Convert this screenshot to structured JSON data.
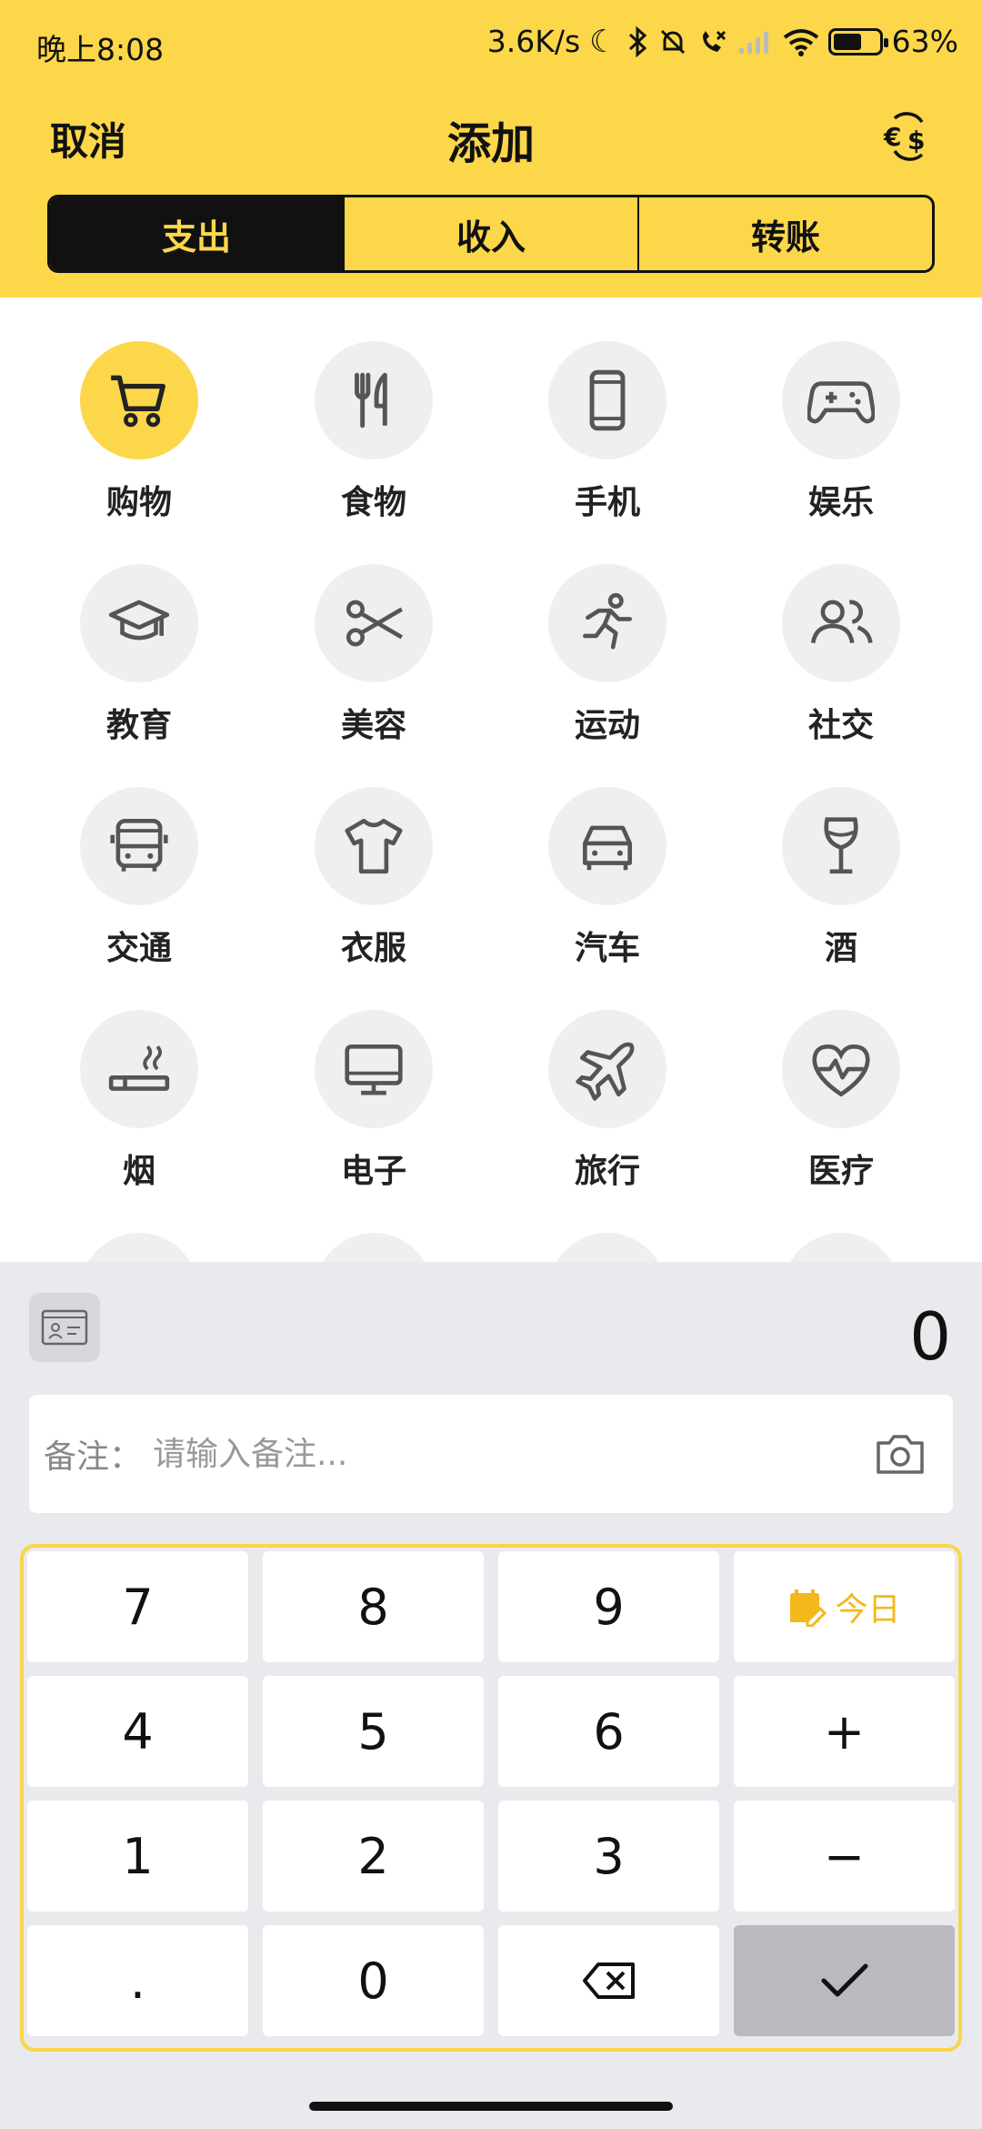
{
  "status_bar": {
    "time": "晚上8:08",
    "network_speed": "3.6K/s",
    "battery_percent": "63%",
    "battery_level": 0.63
  },
  "nav": {
    "cancel_label": "取消",
    "title": "添加",
    "currency_icon": "currency-exchange-icon"
  },
  "tabs": [
    {
      "label": "支出",
      "active": true
    },
    {
      "label": "收入",
      "active": false
    },
    {
      "label": "转账",
      "active": false
    }
  ],
  "categories": [
    {
      "label": "购物",
      "icon": "shopping-cart-icon",
      "selected": true
    },
    {
      "label": "食物",
      "icon": "fork-knife-icon",
      "selected": false
    },
    {
      "label": "手机",
      "icon": "phone-icon",
      "selected": false
    },
    {
      "label": "娱乐",
      "icon": "gamepad-icon",
      "selected": false
    },
    {
      "label": "教育",
      "icon": "graduation-cap-icon",
      "selected": false
    },
    {
      "label": "美容",
      "icon": "scissors-icon",
      "selected": false
    },
    {
      "label": "运动",
      "icon": "running-icon",
      "selected": false
    },
    {
      "label": "社交",
      "icon": "people-icon",
      "selected": false
    },
    {
      "label": "交通",
      "icon": "bus-icon",
      "selected": false
    },
    {
      "label": "衣服",
      "icon": "tshirt-icon",
      "selected": false
    },
    {
      "label": "汽车",
      "icon": "car-icon",
      "selected": false
    },
    {
      "label": "酒",
      "icon": "wine-glass-icon",
      "selected": false
    },
    {
      "label": "烟",
      "icon": "cigarette-icon",
      "selected": false
    },
    {
      "label": "电子",
      "icon": "monitor-icon",
      "selected": false
    },
    {
      "label": "旅行",
      "icon": "airplane-icon",
      "selected": false
    },
    {
      "label": "医疗",
      "icon": "heartbeat-icon",
      "selected": false
    }
  ],
  "entry": {
    "amount": "0",
    "remark_label": "备注：",
    "remark_placeholder": "请输入备注..."
  },
  "keypad": {
    "k7": "7",
    "k8": "8",
    "k9": "9",
    "today": "今日",
    "k4": "4",
    "k5": "5",
    "k6": "6",
    "plus": "+",
    "k1": "1",
    "k2": "2",
    "k3": "3",
    "minus": "−",
    "dot": ".",
    "k0": "0",
    "backspace_icon": "backspace-icon",
    "confirm_icon": "checkmark-icon"
  },
  "colors": {
    "accent": "#FCD74A",
    "active_tab_bg": "#111111",
    "icon_bg": "#EFEFEF",
    "panel_bg": "#E9EAEE",
    "today_color": "#F3B81C"
  }
}
